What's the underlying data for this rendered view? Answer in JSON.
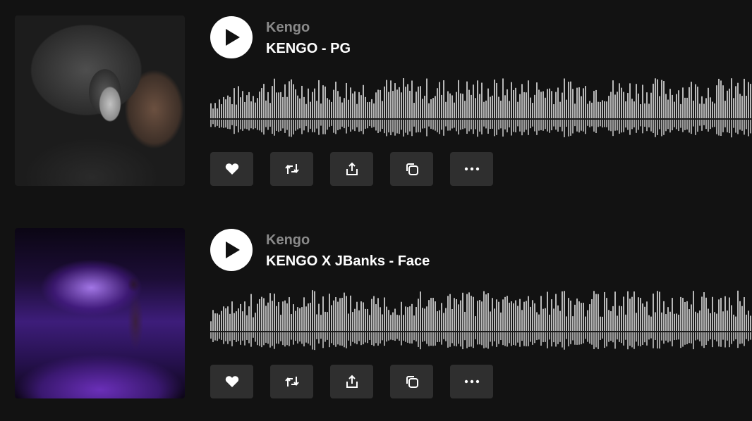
{
  "tracks": [
    {
      "artist": "Kengo",
      "title": "KENGO - PG",
      "artwork_icon": "artwork-photo-headphones",
      "actions": {
        "like_icon": "heart-icon",
        "repost_icon": "repost-icon",
        "share_icon": "share-icon",
        "copy_icon": "copy-icon",
        "more_icon": "more-icon"
      }
    },
    {
      "artist": "Kengo",
      "title": "KENGO X JBanks - Face",
      "artwork_icon": "artwork-photo-concert",
      "actions": {
        "like_icon": "heart-icon",
        "repost_icon": "repost-icon",
        "share_icon": "share-icon",
        "copy_icon": "copy-icon",
        "more_icon": "more-icon"
      }
    }
  ],
  "colors": {
    "background": "#121212",
    "button_bg": "#2f2f2f",
    "waveform": "#b8b8b8",
    "artist_text": "#8a8a8a",
    "title_text": "#ffffff"
  }
}
